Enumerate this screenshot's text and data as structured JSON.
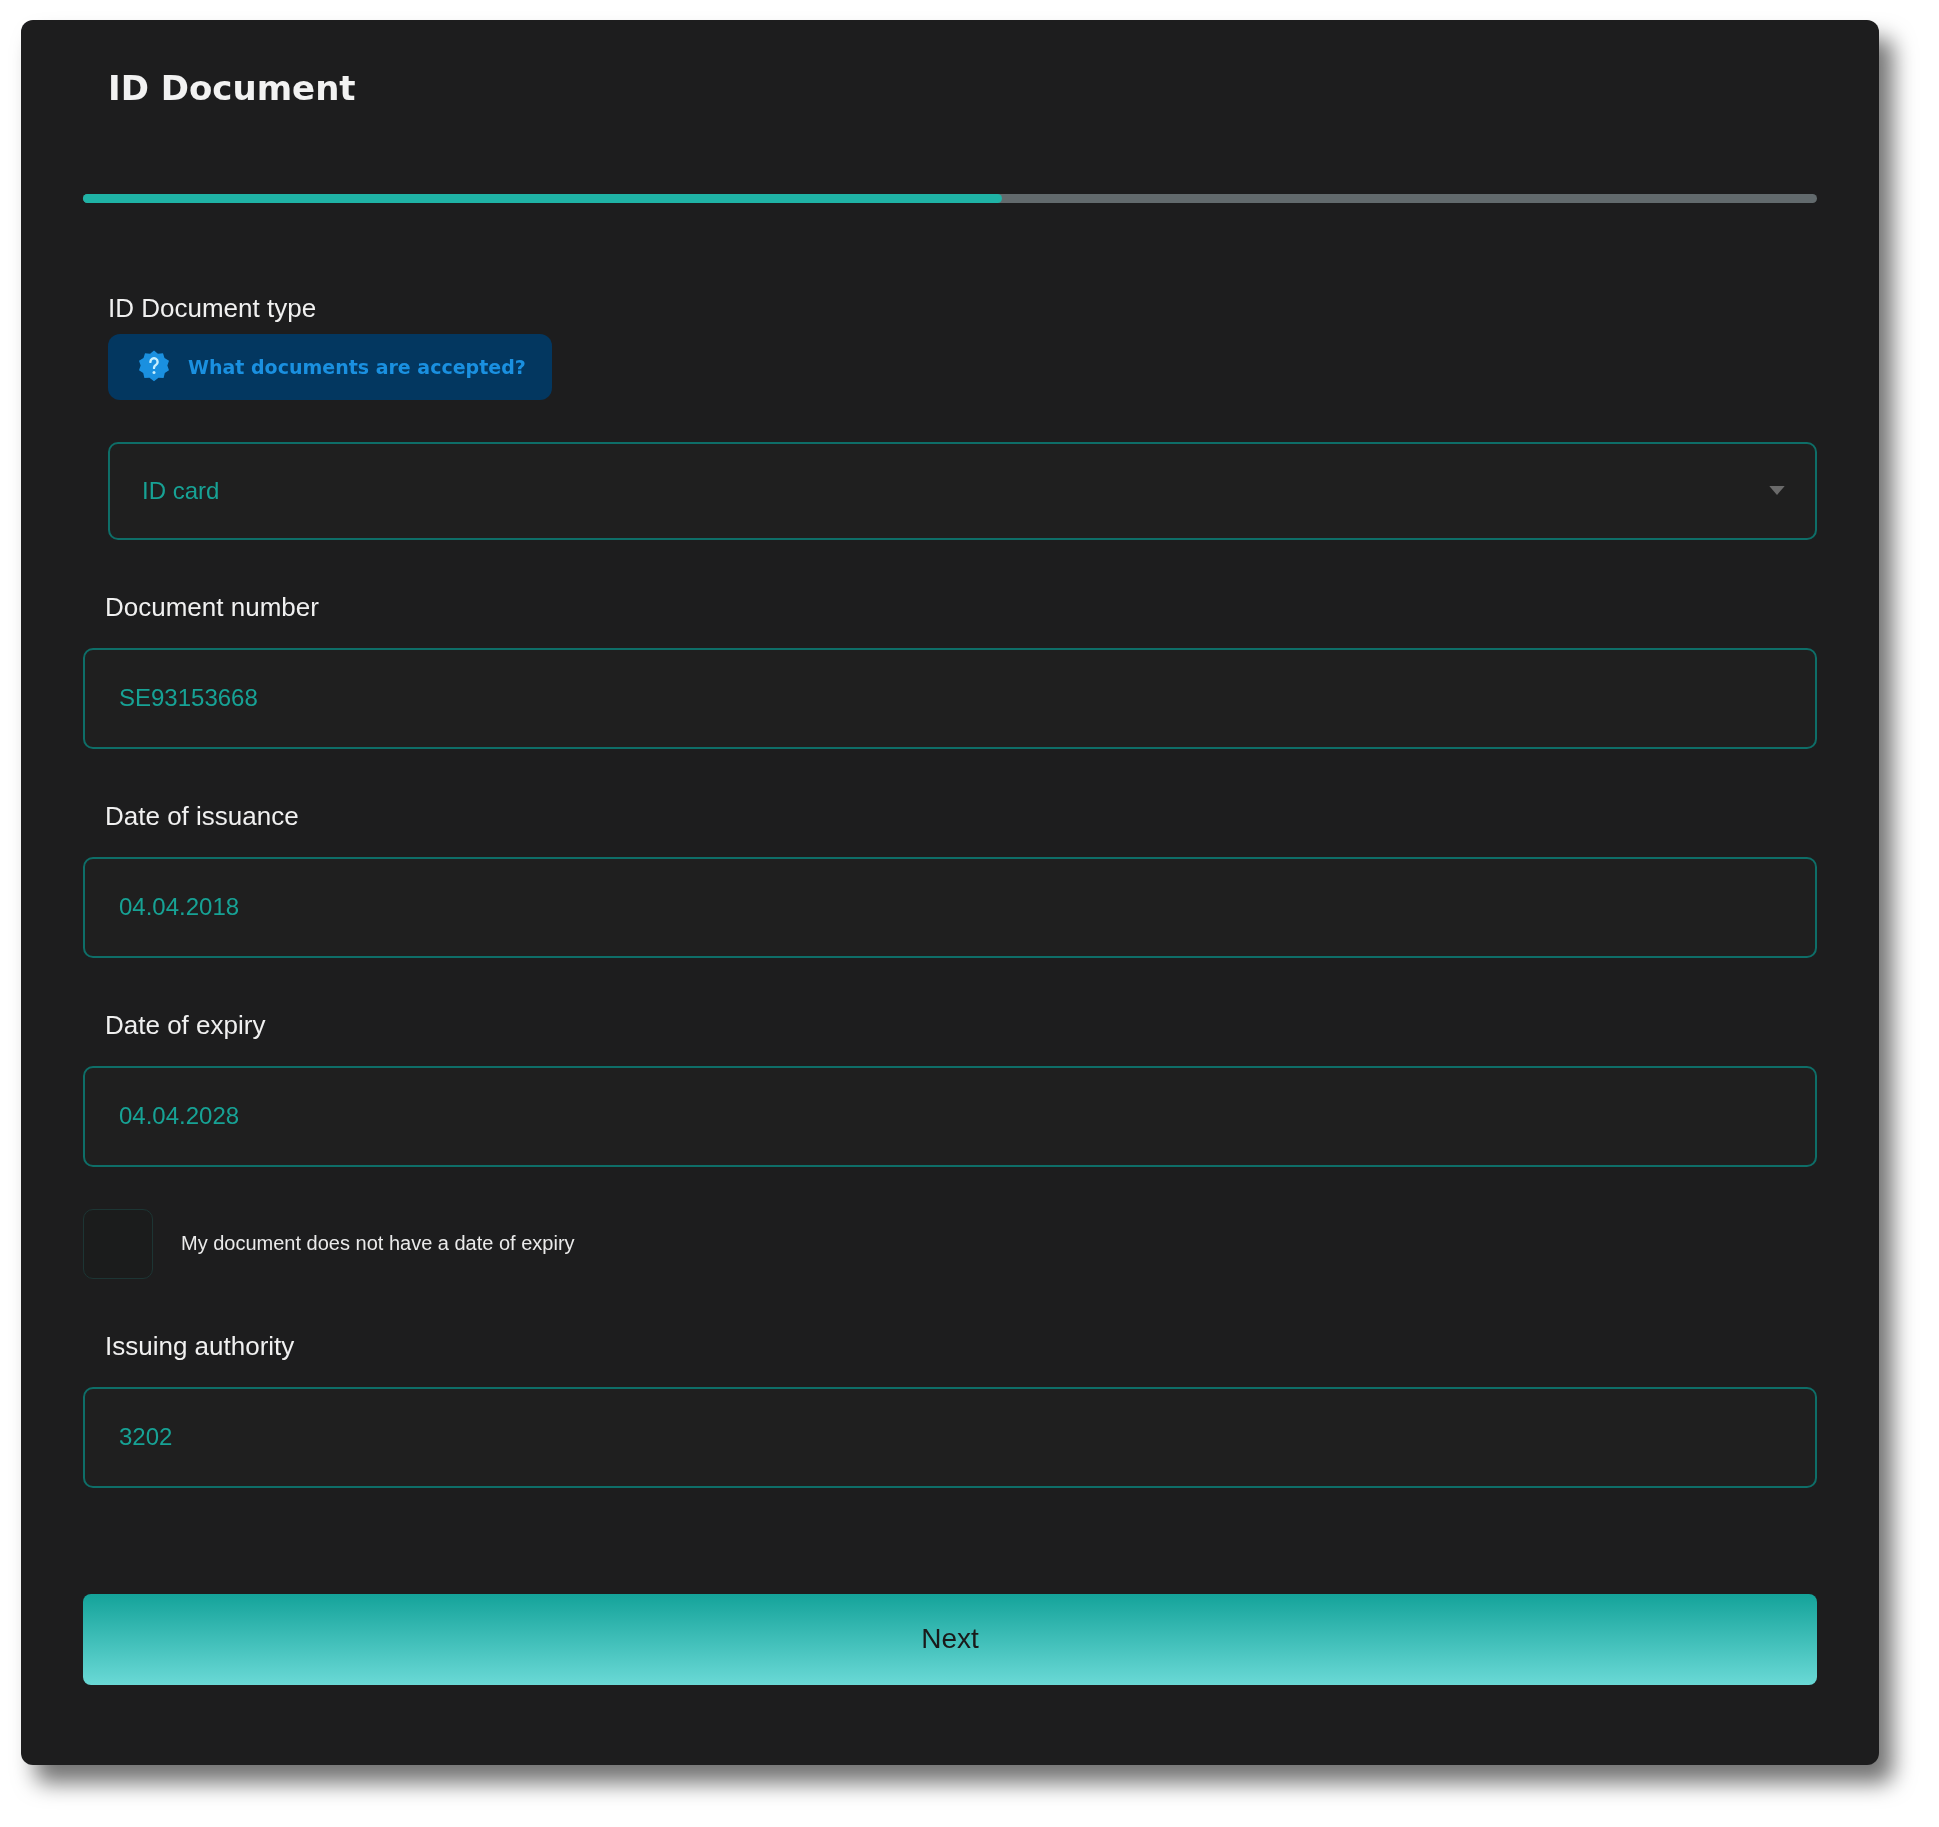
{
  "title": "ID Document",
  "progress": {
    "level": 0.53
  },
  "document_type": {
    "label": "ID Document type",
    "help_link": "What documents are accepted?",
    "value": "ID card"
  },
  "fields": [
    {
      "label": "Document number",
      "value": "SE93153668"
    },
    {
      "label": "Date of issuance",
      "value": "04.04.2018"
    },
    {
      "label": "Date of expiry",
      "value": "04.04.2028"
    }
  ],
  "no_expiry": {
    "label": "My document does not have a date of expiry",
    "checked": false
  },
  "issuing_authority": {
    "label": "Issuing authority",
    "value": "3202"
  },
  "button": "Next"
}
